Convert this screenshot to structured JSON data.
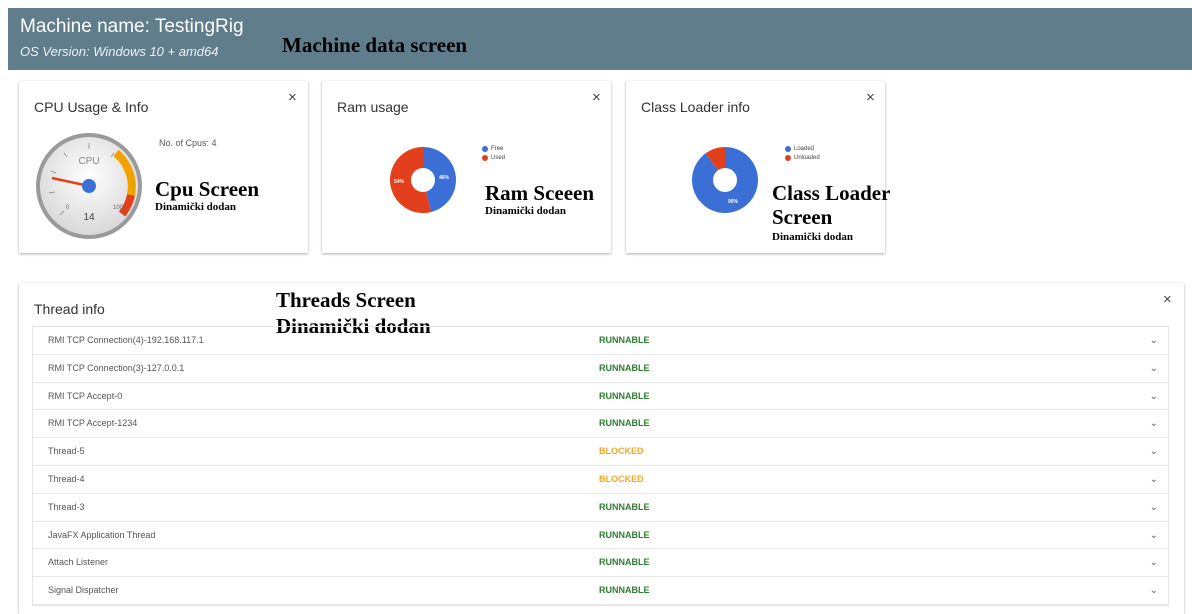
{
  "header": {
    "machine_name": "Machine name: TestingRig",
    "os_version": "OS Version: Windows 10 + amd64"
  },
  "annotations": {
    "machine_screen": "Machine data screen",
    "cpu_screen": "Cpu Screen",
    "cpu_dynamic": "Dinamički dodan",
    "ram_screen": "Ram Sceeen",
    "ram_dynamic": "Dinamički dodan",
    "class_loader_screen_line1": "Class Loader",
    "class_loader_screen_line2": "Screen",
    "class_loader_dynamic": "Dinamički dodan",
    "threads_screen": "Threads Screen",
    "threads_dynamic": "Dinamički dodan"
  },
  "cpu_card": {
    "title": "CPU Usage & Info",
    "close": "×",
    "num_cpus": "No. of Cpus: 4",
    "gauge_label": "CPU",
    "gauge_value": "14",
    "gauge_min": "0",
    "gauge_max": "100",
    "gauge_level": 14
  },
  "ram_card": {
    "title": "Ram usage",
    "close": "×",
    "legend": [
      "Free",
      "Used"
    ],
    "free_pct": "46%",
    "used_pct": "54%",
    "free_value": 46,
    "used_value": 54
  },
  "class_loader_card": {
    "title": "Class Loader info",
    "close": "×",
    "legend": [
      "Loaded",
      "Unloaded"
    ],
    "loaded_pct": "90%",
    "loaded_value": 90,
    "unloaded_value": 10
  },
  "threads_card": {
    "title": "Thread info",
    "close": "×",
    "chevron": "⌄",
    "rows": [
      {
        "name": "RMI TCP Connection(4)-192.168.117.1",
        "state": "RUNNABLE"
      },
      {
        "name": "RMI TCP Connection(3)-127.0.0.1",
        "state": "RUNNABLE"
      },
      {
        "name": "RMI TCP Accept-0",
        "state": "RUNNABLE"
      },
      {
        "name": "RMI TCP Accept-1234",
        "state": "RUNNABLE"
      },
      {
        "name": "Thread-5",
        "state": "BLOCKED"
      },
      {
        "name": "Thread-4",
        "state": "BLOCKED"
      },
      {
        "name": "Thread-3",
        "state": "RUNNABLE"
      },
      {
        "name": "JavaFX Application Thread",
        "state": "RUNNABLE"
      },
      {
        "name": "Attach Listener",
        "state": "RUNNABLE"
      },
      {
        "name": "Signal Dispatcher",
        "state": "RUNNABLE"
      }
    ]
  },
  "colors": {
    "header": "#607d8b",
    "runnable": "#2e7d32",
    "blocked": "#f5a623",
    "blue": "#3b6fd6",
    "red": "#e2401c"
  }
}
